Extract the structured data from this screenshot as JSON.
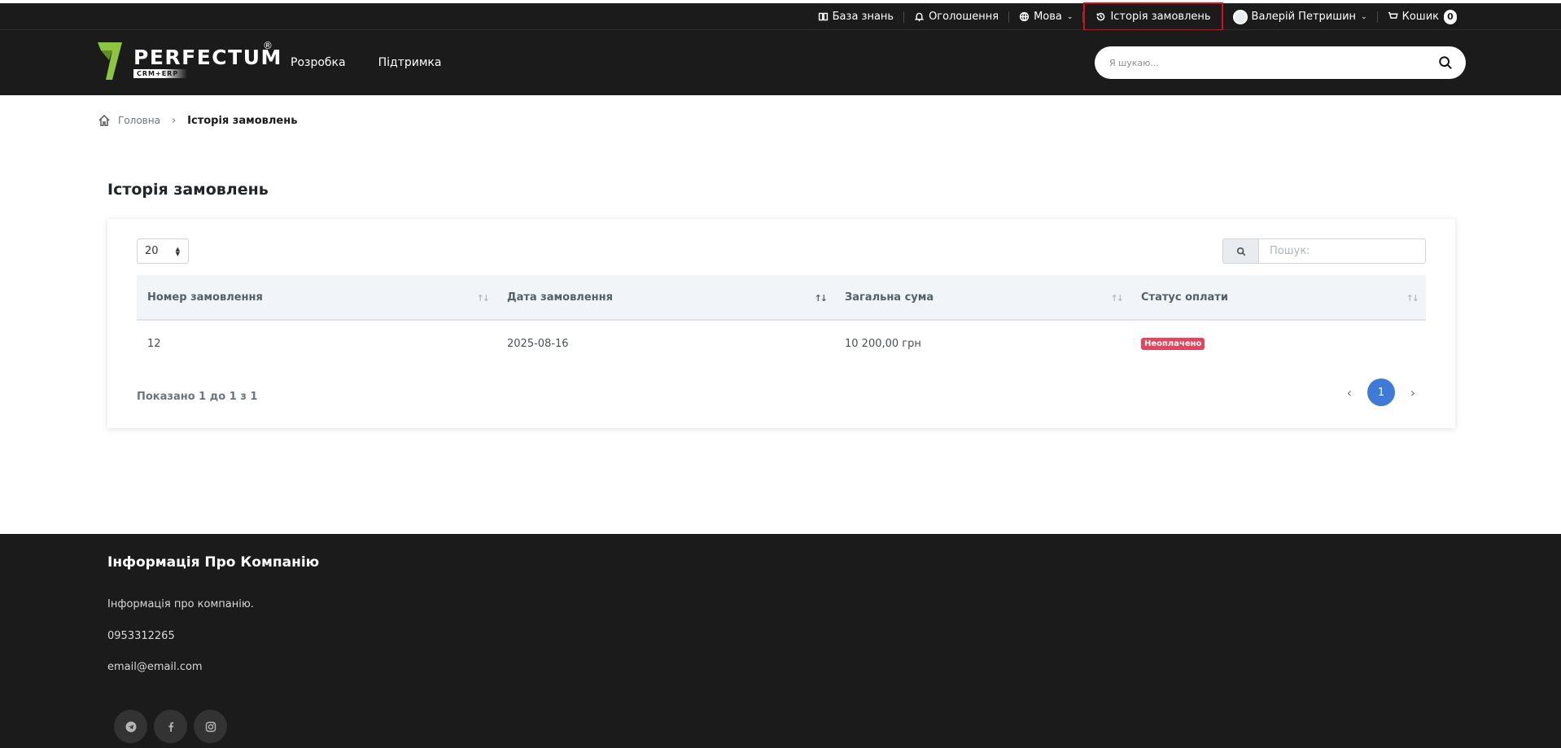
{
  "topbar": {
    "knowledge_base": "База знань",
    "announcements": "Оголошення",
    "language": "Мова",
    "order_history": "Історія замовлень",
    "user_name": "Валерій Петришин",
    "cart_label": "Кошик",
    "cart_count": "0"
  },
  "header": {
    "logo_text": "PERFECTUM",
    "logo_reg": "®",
    "logo_sub": "CRM+ERP",
    "nav": [
      "Розробка",
      "Підтримка"
    ],
    "search_placeholder": "Я шукаю..."
  },
  "breadcrumb": {
    "home": "Головна",
    "current": "Історія замовлень"
  },
  "page_title": "Історія замовлень",
  "table": {
    "page_length": "20",
    "search_placeholder": "Пошук:",
    "columns": [
      "Номер замовлення",
      "Дата замовлення",
      "Загальна сума",
      "Статус оплати"
    ],
    "rows": [
      {
        "number": "12",
        "date": "2025-08-16",
        "total": "10 200,00 грн",
        "status": "Неоплачено"
      }
    ],
    "info": "Показано 1 до 1 з 1",
    "current_page": "1"
  },
  "colors": {
    "dark_bg": "#1c1b1b",
    "accent_blue": "#3e7bd6",
    "unpaid_red": "#e2465d",
    "logo_green": "#8cc63f",
    "highlight_red": "#e10a14"
  },
  "footer": {
    "title": "Інформація Про Компанію",
    "description": "Інформація про компанію.",
    "phone": "0953312265",
    "email": "email@email.com",
    "socials": [
      "telegram-icon",
      "facebook-icon",
      "instagram-icon"
    ]
  }
}
